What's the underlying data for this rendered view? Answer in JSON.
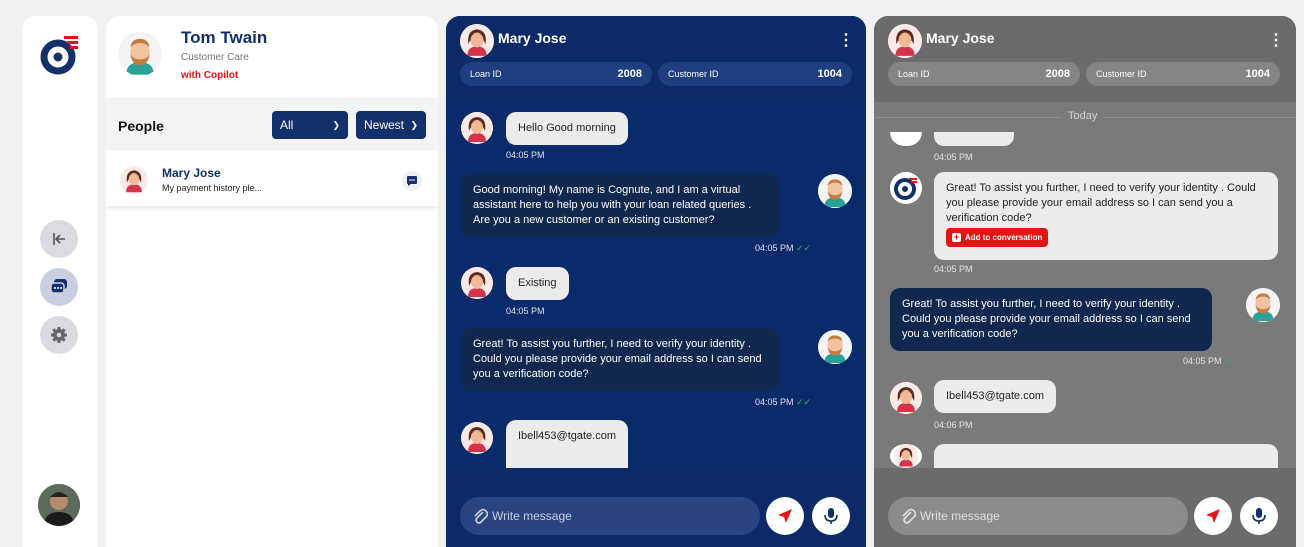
{
  "agent": {
    "name": "Tom Twain",
    "role": "Customer Care",
    "copilot": "with Copilot"
  },
  "people": {
    "title": "People",
    "filter": "All",
    "sort": "Newest",
    "items": [
      {
        "name": "Mary Jose",
        "preview": "My payment history ple..."
      }
    ]
  },
  "chat_main": {
    "name": "Mary Jose",
    "loan_label": "Loan ID",
    "loan_id": "2008",
    "customer_label": "Customer ID",
    "customer_id": "1004",
    "placeholder": "Write message",
    "messages": [
      {
        "text": "Hello Good morning",
        "time": "04:05 PM"
      },
      {
        "text": "Good morning! My name is Cognute, and I am a virtual assistant here to help you with your loan related queries . Are you a new customer or an existing customer?",
        "time": "04:05 PM"
      },
      {
        "text": "Existing",
        "time": "04:05 PM"
      },
      {
        "text": "Great! To assist you further, I need to verify your identity . Could you please provide your email address so I can send you a verification code?",
        "time": "04:05 PM"
      },
      {
        "text": "Ibell453@tgate.com"
      }
    ]
  },
  "chat_copilot": {
    "name": "Mary Jose",
    "loan_label": "Loan ID",
    "loan_id": "2008",
    "customer_label": "Customer ID",
    "customer_id": "1004",
    "today": "Today",
    "placeholder": "Write message",
    "add_label": "Add to conversation",
    "messages": [
      {
        "time": "04:05 PM"
      },
      {
        "text": "Great! To assist you further, I need to verify your identity . Could you please provide your email address so I can send you a verification code?",
        "time": "04:05 PM"
      },
      {
        "text": "Great! To assist you further, I need to verify your identity . Could you please provide your email address so I can send you a verification code?",
        "time": "04:05 PM"
      },
      {
        "text": "Ibell453@tgate.com",
        "time": "04:06 PM"
      }
    ]
  },
  "colors": {
    "navy": "#13306b",
    "accent_red": "#e41414"
  }
}
